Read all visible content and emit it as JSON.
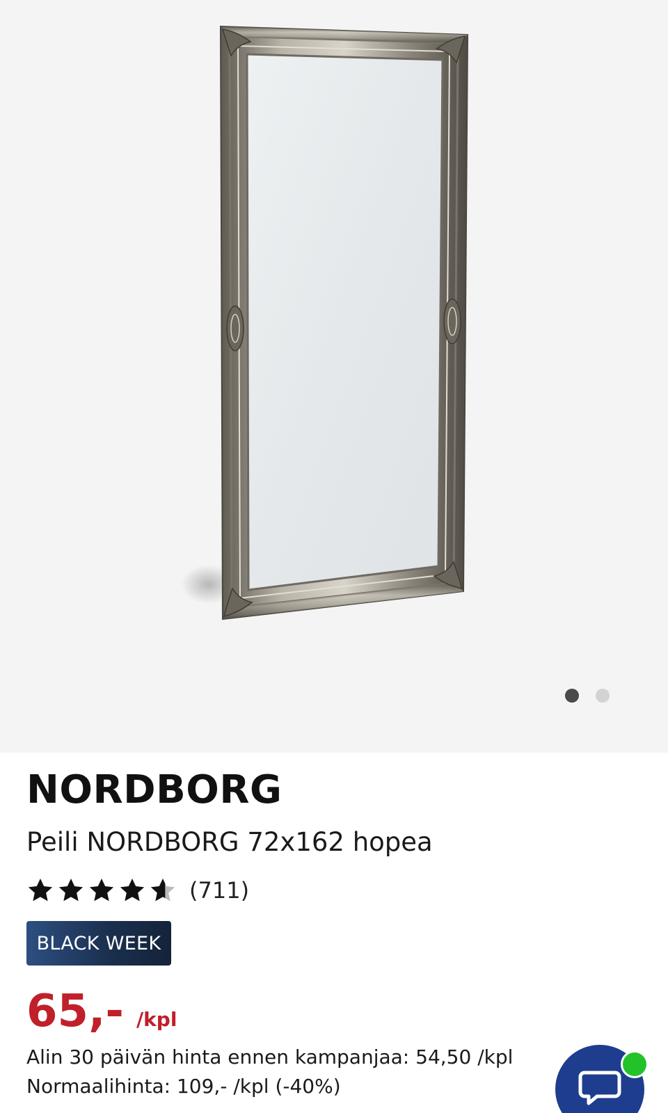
{
  "gallery": {
    "image_alt": "Peili NORDBORG 72x162 hopea",
    "dot_count": 2,
    "active_dot": 1
  },
  "product": {
    "brand": "NORDBORG",
    "title": "Peili NORDBORG 72x162 hopea",
    "rating": 4.5,
    "rating_max": 5,
    "review_count": "(711)",
    "badge": "BLACK WEEK",
    "price": "65,-",
    "price_unit": "/kpl",
    "lowest_30_days": "Alin 30 päivän hinta ennen kampanjaa: 54,50 /kpl",
    "normal_price": "Normaalihinta: 109,- /kpl (-40%)"
  },
  "colors": {
    "price": "#c0202a",
    "badge": "#1a2e4d",
    "chat_button": "#1f3d8f",
    "online_indicator": "#22c32a"
  },
  "icons": {
    "chat": "chat-bubble-icon",
    "star": "star-icon"
  }
}
